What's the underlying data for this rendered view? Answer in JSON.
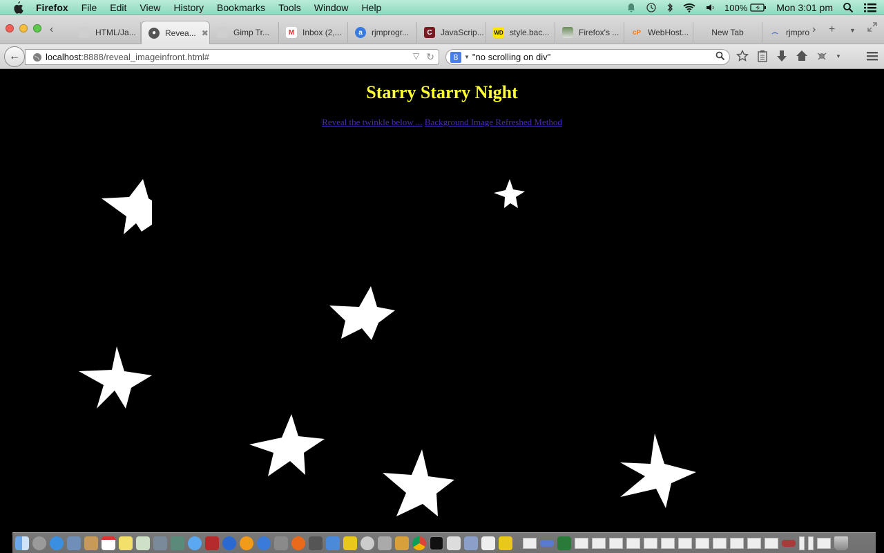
{
  "menubar": {
    "app": "Firefox",
    "items": [
      "File",
      "Edit",
      "View",
      "History",
      "Bookmarks",
      "Tools",
      "Window",
      "Help"
    ],
    "battery": "100%",
    "clock": "Mon 3:01 pm"
  },
  "tabs": [
    {
      "label": "HTML/Ja...",
      "icon": "generic-page-icon",
      "active": false
    },
    {
      "label": "Revea...",
      "icon": "globe-icon",
      "active": true
    },
    {
      "label": "Gimp Tr...",
      "icon": "generic-page-icon",
      "active": false
    },
    {
      "label": "Inbox (2,...",
      "icon": "gmail-icon",
      "active": false
    },
    {
      "label": "rjmprogr...",
      "icon": "a-icon",
      "active": false
    },
    {
      "label": "JavaScrip...",
      "icon": "c-icon",
      "active": false
    },
    {
      "label": "style.bac...",
      "icon": "wd-icon",
      "active": false
    },
    {
      "label": "Firefox's ...",
      "icon": "zine-icon",
      "active": false
    },
    {
      "label": "WebHost...",
      "icon": "cpanel-icon",
      "active": false
    },
    {
      "label": "New Tab",
      "icon": "",
      "active": false
    },
    {
      "label": "rjmpro",
      "icon": "swirl-icon",
      "active": false
    }
  ],
  "navbar": {
    "url_host": "localhost",
    "url_rest": ":8888/reveal_imageinfront.html#",
    "search_value": "\"no scrolling on div\""
  },
  "page": {
    "title": "Starry Starry Night",
    "link1": "Reveal the twinkle below ...",
    "separator": " ",
    "link2": "Background Image Refreshed Method",
    "title_color": "#ffff33",
    "link_color": "#4a2bb0",
    "background_color": "#000000",
    "star_color": "#ffffff"
  }
}
